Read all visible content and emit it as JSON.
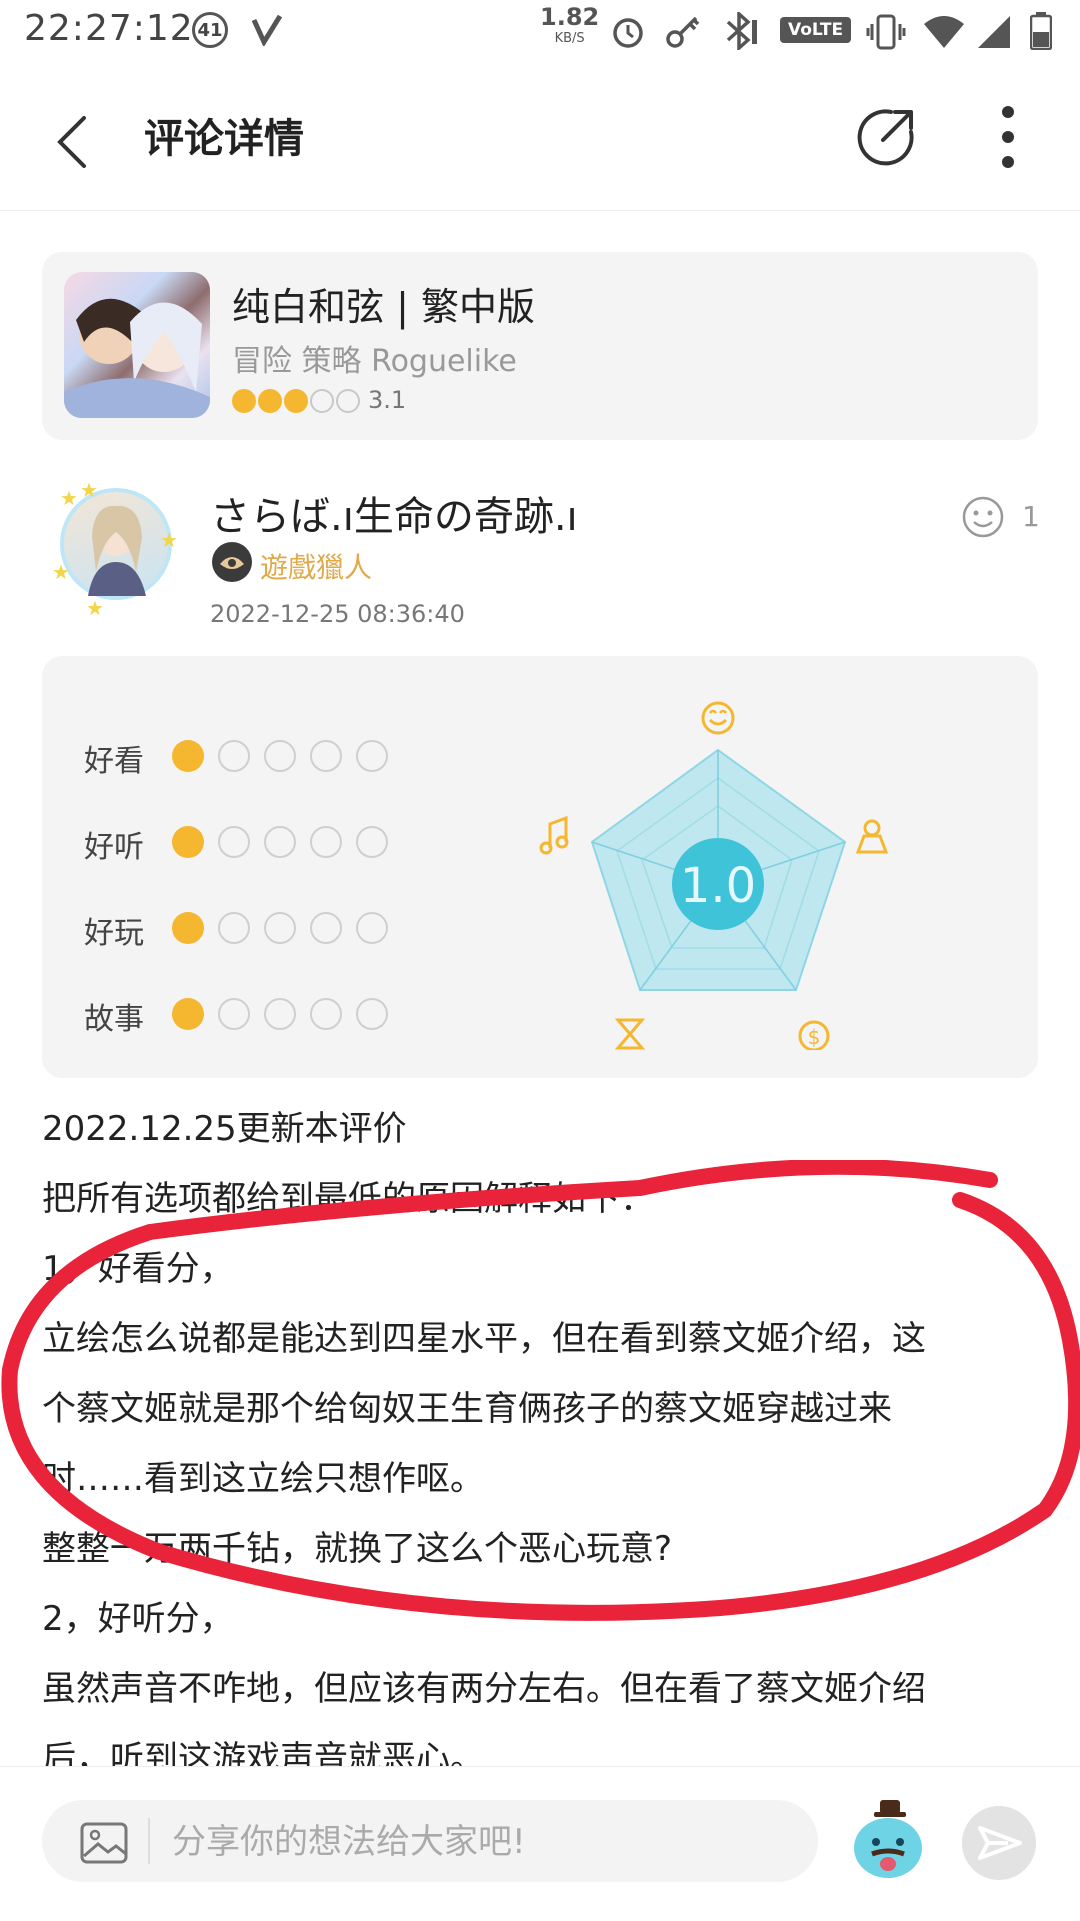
{
  "status_bar": {
    "time": "22:27:12",
    "notif_count": "41",
    "net_rate": "1.82",
    "net_unit": "KB/S",
    "volte": "VoLTE"
  },
  "app_bar": {
    "title": "评论详情"
  },
  "game": {
    "title": "纯白和弦 | 繁中版",
    "tags": "冒险  策略  Roguelike",
    "rating": 3,
    "rating_max": 5,
    "score": "3.1"
  },
  "review": {
    "author": "さらば.ı生命の奇跡.ı",
    "badge": "遊戲獵人",
    "date": "2022-12-25 08:36:40",
    "like_count": "1",
    "ratings": [
      {
        "label": "好看",
        "score": 1,
        "max": 5
      },
      {
        "label": "好听",
        "score": 1,
        "max": 5
      },
      {
        "label": "好玩",
        "score": 1,
        "max": 5
      },
      {
        "label": "故事",
        "score": 1,
        "max": 5
      }
    ],
    "overall_score": "1.0",
    "body_lines": [
      "2022.12.25更新本评价",
      "把所有选项都给到最低的原因解释如下：",
      "1，好看分，",
      "立绘怎么说都是能达到四星水平，但在看到蔡文姬介绍，这",
      "个蔡文姬就是那个给匈奴王生育俩孩子的蔡文姬穿越过来",
      "时……看到这立绘只想作呕。",
      "整整一万两千钻，就换了这么个恶心玩意?",
      "2，好听分，",
      "虽然声音不咋地，但应该有两分左右。但在看了蔡文姬介绍",
      "后，听到这游戏声音就恶心。"
    ]
  },
  "comment": {
    "placeholder": "分享你的想法给大家吧!"
  },
  "colors": {
    "accent_orange": "#f5b630",
    "radar_teal": "#3fc3d8",
    "annotation_red": "#e8233a"
  }
}
